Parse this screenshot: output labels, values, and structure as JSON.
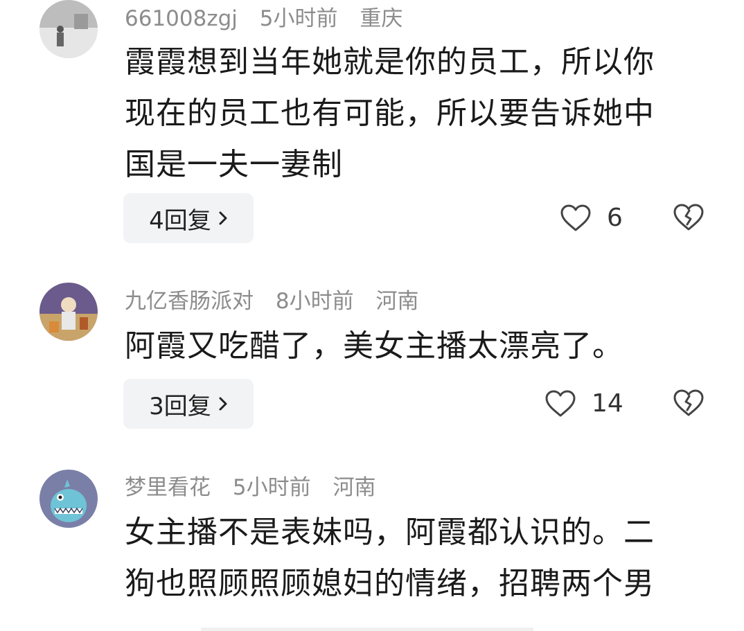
{
  "comments": [
    {
      "username": "661008zgj",
      "time": "5小时前",
      "location": "重庆",
      "lines": [
        "霞霞想到当年她就是你的员工，所以你",
        "现在的员工也有可能，所以要告诉她中",
        "国是一夫一妻制"
      ],
      "reply_label": "4回复",
      "likes": "6"
    },
    {
      "username": "九亿香肠派对",
      "time": "8小时前",
      "location": "河南",
      "lines": [
        "阿霞又吃醋了，美女主播太漂亮了。"
      ],
      "reply_label": "3回复",
      "likes": "14"
    },
    {
      "username": "梦里看花",
      "time": "5小时前",
      "location": "河南",
      "lines": [
        "女主播不是表妹吗，阿霞都认识的。二",
        "狗也照顾照顾媳妇的情绪，招聘两个男"
      ]
    }
  ],
  "icons": {
    "reply_chevron": "chevron-right-icon",
    "like": "heart-outline-icon",
    "dislike": "broken-heart-icon"
  }
}
